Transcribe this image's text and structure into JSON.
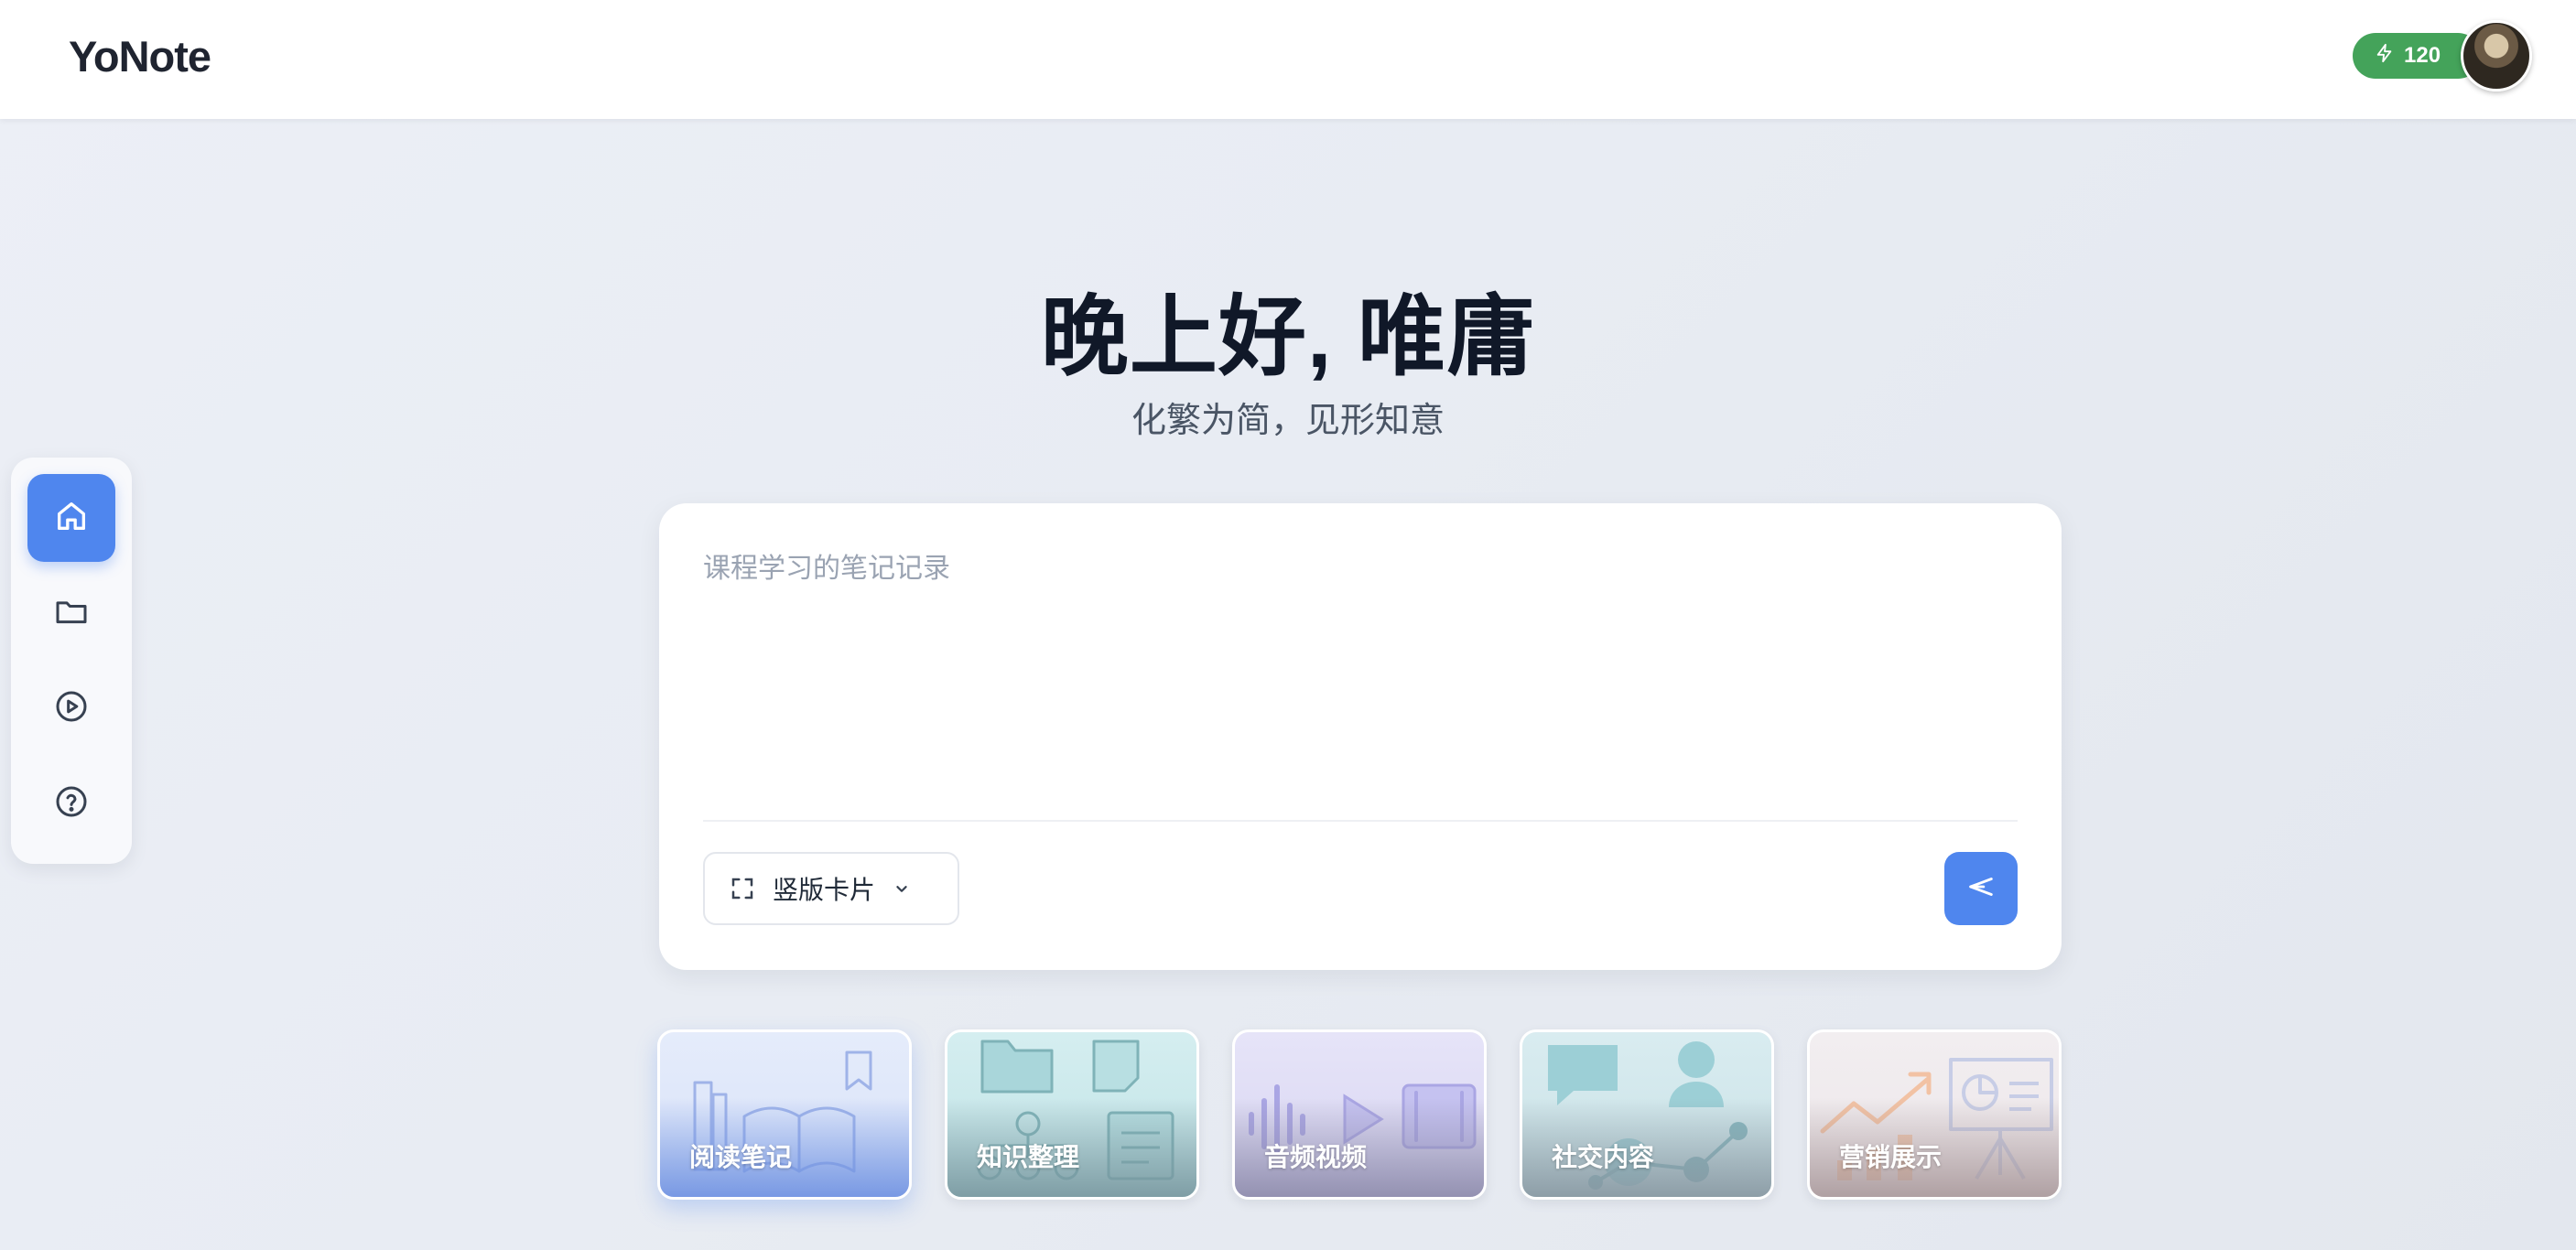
{
  "header": {
    "logo": "YoNote",
    "credits": "120",
    "credits_icon": "lightning-bolt-icon",
    "avatar": "user-avatar"
  },
  "sidebar": {
    "items": [
      {
        "name": "home",
        "icon": "home-icon",
        "active": true
      },
      {
        "name": "folder",
        "icon": "folder-icon",
        "active": false
      },
      {
        "name": "play",
        "icon": "play-circle-icon",
        "active": false
      },
      {
        "name": "help",
        "icon": "help-circle-icon",
        "active": false
      }
    ]
  },
  "hero": {
    "greeting": "晚上好, 唯庸",
    "subtitle": "化繁为简，见形知意"
  },
  "composer": {
    "placeholder": "课程学习的笔记记录",
    "value": "",
    "format_label": "竖版卡片",
    "format_icon": "fullscreen-frame-icon",
    "send_icon": "send-icon"
  },
  "templates": [
    {
      "label": "阅读笔记",
      "icon": "book-icon",
      "selected": true
    },
    {
      "label": "知识整理",
      "icon": "folder-notes-icon",
      "selected": false
    },
    {
      "label": "音频视频",
      "icon": "audio-video-icon",
      "selected": false
    },
    {
      "label": "社交内容",
      "icon": "social-chat-icon",
      "selected": false
    },
    {
      "label": "营销展示",
      "icon": "presentation-chart-icon",
      "selected": false
    }
  ],
  "colors": {
    "accent": "#4f86ee",
    "credits_badge": "#44a35a",
    "heading": "#101828",
    "background": "#e9edf4"
  }
}
